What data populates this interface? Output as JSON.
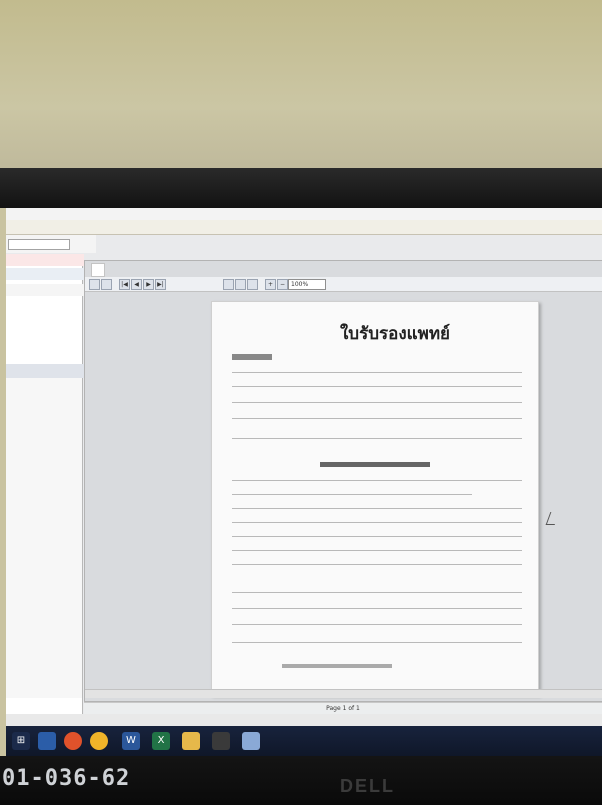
{
  "document": {
    "title": "ใบรับรองแพทย์"
  },
  "viewer": {
    "status_page": "Page 1 of 1",
    "zoom": "100%"
  },
  "icons": [
    "start-icon",
    "word-icon",
    "excel-icon",
    "folder-icon",
    "app-icon"
  ],
  "sticker": "01-036-62",
  "brand": "DELL",
  "colors": {
    "wall": "#c9c3a0",
    "taskbar": "#18233d",
    "page": "#fafafa",
    "menu_text": "#2d2d7a"
  }
}
